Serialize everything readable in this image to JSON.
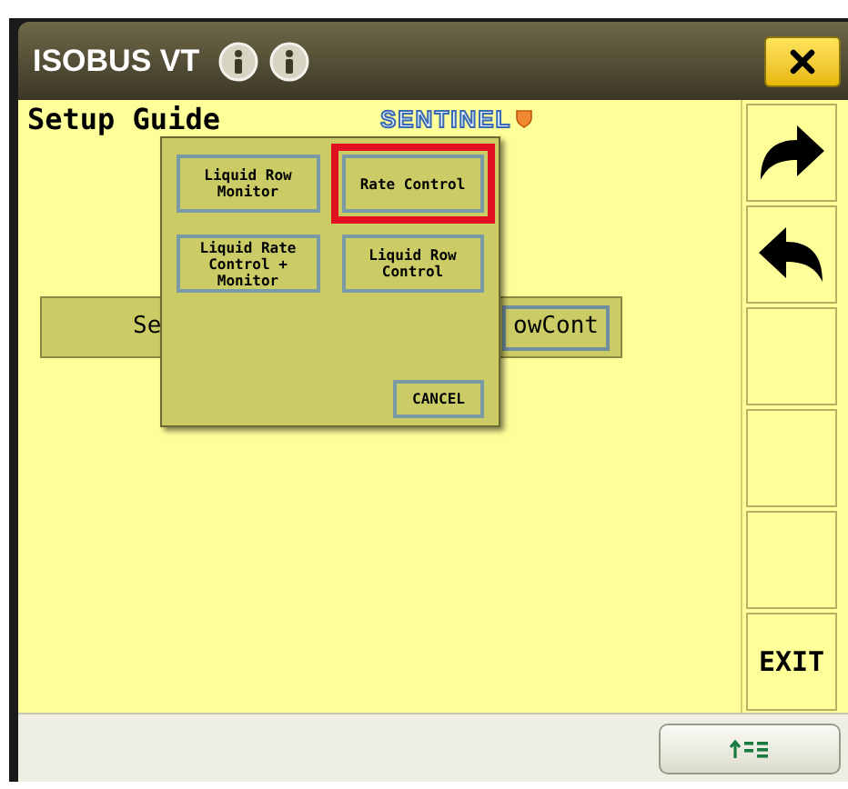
{
  "window": {
    "title": "ISOBUS VT"
  },
  "main": {
    "heading": "Setup Guide",
    "logo": "SENTINEL",
    "bar_text": "Se",
    "bar_button": "owCont"
  },
  "dialog": {
    "options": [
      {
        "label": "Liquid Row Monitor",
        "selected": false
      },
      {
        "label": "Rate Control",
        "selected": true
      },
      {
        "label": "Liquid Rate Control + Monitor",
        "selected": false
      },
      {
        "label": "Liquid Row Control",
        "selected": false
      }
    ],
    "cancel": "CANCEL"
  },
  "soft_keys": [
    {
      "kind": "forward"
    },
    {
      "kind": "back"
    },
    {
      "kind": "blank"
    },
    {
      "kind": "blank"
    },
    {
      "kind": "blank"
    },
    {
      "kind": "text",
      "label": "EXIT"
    }
  ]
}
